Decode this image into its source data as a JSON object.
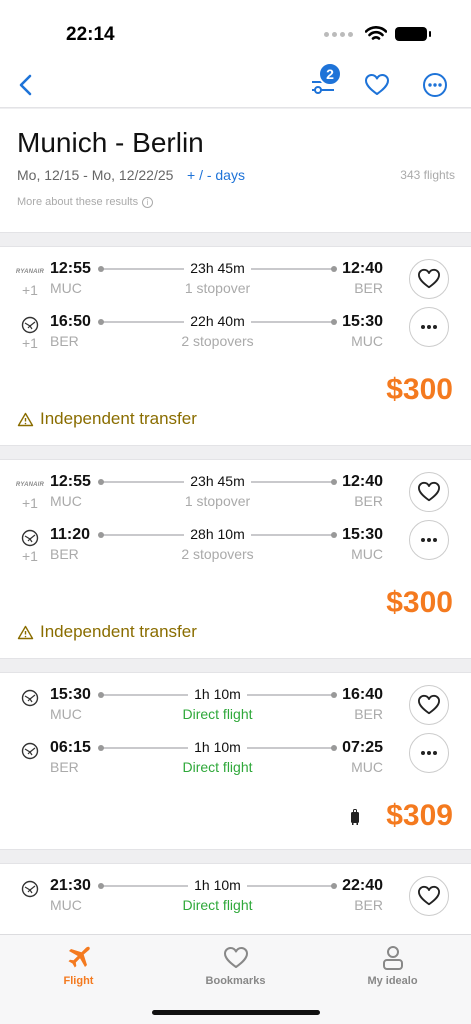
{
  "status": {
    "time": "22:14"
  },
  "nav": {
    "filter_badge": "2"
  },
  "search": {
    "route": "Munich - Berlin",
    "dates": "Mo, 12/15 - Mo, 12/22/25",
    "flex_days": "+ / - days",
    "count": "343 flights",
    "more_info": "More about these results"
  },
  "results": [
    {
      "outbound": {
        "airline_logo": "RYANAIR",
        "plus_day": "+1",
        "dep_time": "12:55",
        "dep_code": "MUC",
        "duration": "23h 45m",
        "stops": "1 stopover",
        "arr_time": "12:40",
        "arr_code": "BER"
      },
      "inbound": {
        "airline_logo": "lufthansa-crane",
        "plus_day": "+1",
        "dep_time": "16:50",
        "dep_code": "BER",
        "duration": "22h 40m",
        "stops": "2 stopovers",
        "arr_time": "15:30",
        "arr_code": "MUC"
      },
      "price": "$300",
      "warning": "Independent transfer"
    },
    {
      "outbound": {
        "airline_logo": "RYANAIR",
        "plus_day": "+1",
        "dep_time": "12:55",
        "dep_code": "MUC",
        "duration": "23h 45m",
        "stops": "1 stopover",
        "arr_time": "12:40",
        "arr_code": "BER"
      },
      "inbound": {
        "airline_logo": "lufthansa-crane",
        "plus_day": "+1",
        "dep_time": "11:20",
        "dep_code": "BER",
        "duration": "28h 10m",
        "stops": "2 stopovers",
        "arr_time": "15:30",
        "arr_code": "MUC"
      },
      "price": "$300",
      "warning": "Independent transfer"
    },
    {
      "outbound": {
        "airline_logo": "lufthansa-crane",
        "dep_time": "15:30",
        "dep_code": "MUC",
        "duration": "1h 10m",
        "stops": "Direct flight",
        "arr_time": "16:40",
        "arr_code": "BER"
      },
      "inbound": {
        "airline_logo": "lufthansa-crane",
        "dep_time": "06:15",
        "dep_code": "BER",
        "duration": "1h 10m",
        "stops": "Direct flight",
        "arr_time": "07:25",
        "arr_code": "MUC"
      },
      "price": "$309"
    },
    {
      "outbound": {
        "airline_logo": "lufthansa-crane",
        "dep_time": "21:30",
        "dep_code": "MUC",
        "duration": "1h 10m",
        "stops": "Direct flight",
        "arr_time": "22:40",
        "arr_code": "BER"
      }
    }
  ],
  "tabs": [
    {
      "label": "Flight",
      "icon": "plane-icon",
      "active": true
    },
    {
      "label": "Bookmarks",
      "icon": "heart-icon",
      "active": false
    },
    {
      "label": "My idealo",
      "icon": "person-icon",
      "active": false
    }
  ],
  "colors": {
    "accent": "#f47a1f",
    "link": "#1e73d8",
    "direct": "#2fa83a",
    "warning": "#8a6d00"
  }
}
